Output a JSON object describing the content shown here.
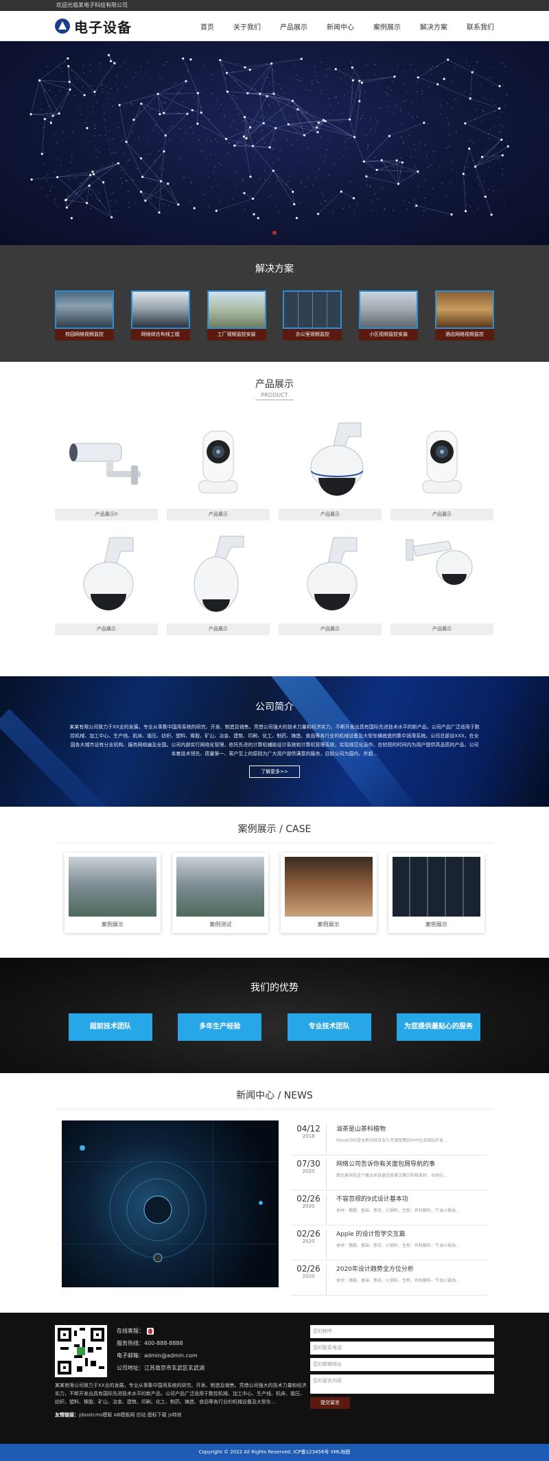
{
  "topbar": {
    "welcome": "欢迎光临某电子科技有限公司"
  },
  "logo": {
    "text": "电子设备"
  },
  "nav": [
    "首页",
    "关于我们",
    "产品展示",
    "新闻中心",
    "案例展示",
    "解决方案",
    "联系我们"
  ],
  "solutions": {
    "title": "解决方案",
    "items": [
      "校园网络视频监控",
      "网络综合布线工程",
      "工厂视频监控安装",
      "办公室视频监控",
      "小区视频监控安装",
      "酒店网络视频监控"
    ]
  },
  "products": {
    "title": "产品展示",
    "subtitle": "PRODUCT",
    "items": [
      "产品展示0",
      "产品展示",
      "产品展示",
      "产品展示",
      "产品展示",
      "产品展示",
      "产品展示",
      "产品展示"
    ]
  },
  "about": {
    "title": "公司简介",
    "text": "某某有限公司致力于XX业的发展，专业从事集中国用系统的研究、开发、制造及销售。凭借公司强大的技术力量和经济实力，不断开发出具有国际先进技术水平的新产品，公司产品广泛适用于数控机械、加工中心、生产线、机床、锻压、纺织、塑料、橡胶、矿山、冶金、建筑、印刷、化工、制药、铸造、食品等各行业的机械设备及大型车辆底盘的集中润滑系统。公司总部设XXX，在全国各大城市设有分支机构、服务网络遍及全国。公司内部实行网络化管理，依托先进的计算机辅助设计系统和计算机管理系统，实现规范化运作。在较短的时间内为用户提供高品质的产品。公司本着技术领先、质量第一、客户至上的原则为广大用户提供满意的服务，目前公司为国内、外超…",
    "button": "了解更多>>"
  },
  "cases": {
    "title": "案例展示 / CASE",
    "items": [
      "案例展示",
      "案例测试",
      "案例展示",
      "案例展示"
    ]
  },
  "advantage": {
    "title": "我们的优势",
    "items": [
      "超前技术团队",
      "多年生产经验",
      "专业技术团队",
      "为您提供最贴心的服务"
    ]
  },
  "news": {
    "title": "新闻中心 / NEWS",
    "items": [
      {
        "md": "04/12",
        "year": "2018",
        "title": "油茶是山茶科植物",
        "desc": "PbootCMS是全新内核且永久开源免费的PHP企业网站开发…"
      },
      {
        "md": "07/30",
        "year": "2020",
        "title": "网络公司告诉你有关面包屑导航的事",
        "desc": "面包屑导航这个概念来自童话故事汉赛尔和格莱特，当他们…"
      },
      {
        "md": "02/26",
        "year": "2020",
        "title": "不容忽视的9式设计基本功",
        "desc": "食材：猪腿、香菇、葱花、火锅料、生粉、有机酿料、牛油火锅油…"
      },
      {
        "md": "02/26",
        "year": "2020",
        "title": "Apple 的设计哲学交互篇",
        "desc": "食材：猪腿、香菇、葱花、火锅料、生粉、有机酿料、牛油火锅油…"
      },
      {
        "md": "02/26",
        "year": "2020",
        "title": "2020年设计趋势全方位分析",
        "desc": "食材：猪腿、香菇、葱花、火锅料、生粉、有机酿料、牛油火锅油…"
      }
    ]
  },
  "footer": {
    "qq_label": "在线客服：",
    "phone": "服务热线：400-888-8888",
    "email": "电子邮箱：admin@admin.com",
    "address": "公司地址：江苏南京市玄武区玄武湖",
    "intro": "某某有限公司致力于XX业的发展，专业从事集中国用系统的研究、开发、制造及销售。凭借公司强大的技术力量和经济实力，不断开发出具有国际先进技术水平的新产品，公司产品广泛适用于数控机械、加工中心、生产线、机床、锻压、纺织、塑料、橡胶、矿山、冶金、建筑、印刷、化工、制药、铸造、食品等各行业的机械设备及大型车…",
    "links_label": "友情链接：",
    "links": "pbootcms模板 AB模板网 仿站 图标下载 js特效",
    "form": {
      "name": "您的称呼",
      "phone": "您的联系电话",
      "email": "您的邮箱地址",
      "message": "您的留言内容",
      "submit": "提交留言"
    }
  },
  "bottom": {
    "copyright": "Copyright © 2022 All Rights Reserved.   ICP备123456号   XML地图"
  }
}
